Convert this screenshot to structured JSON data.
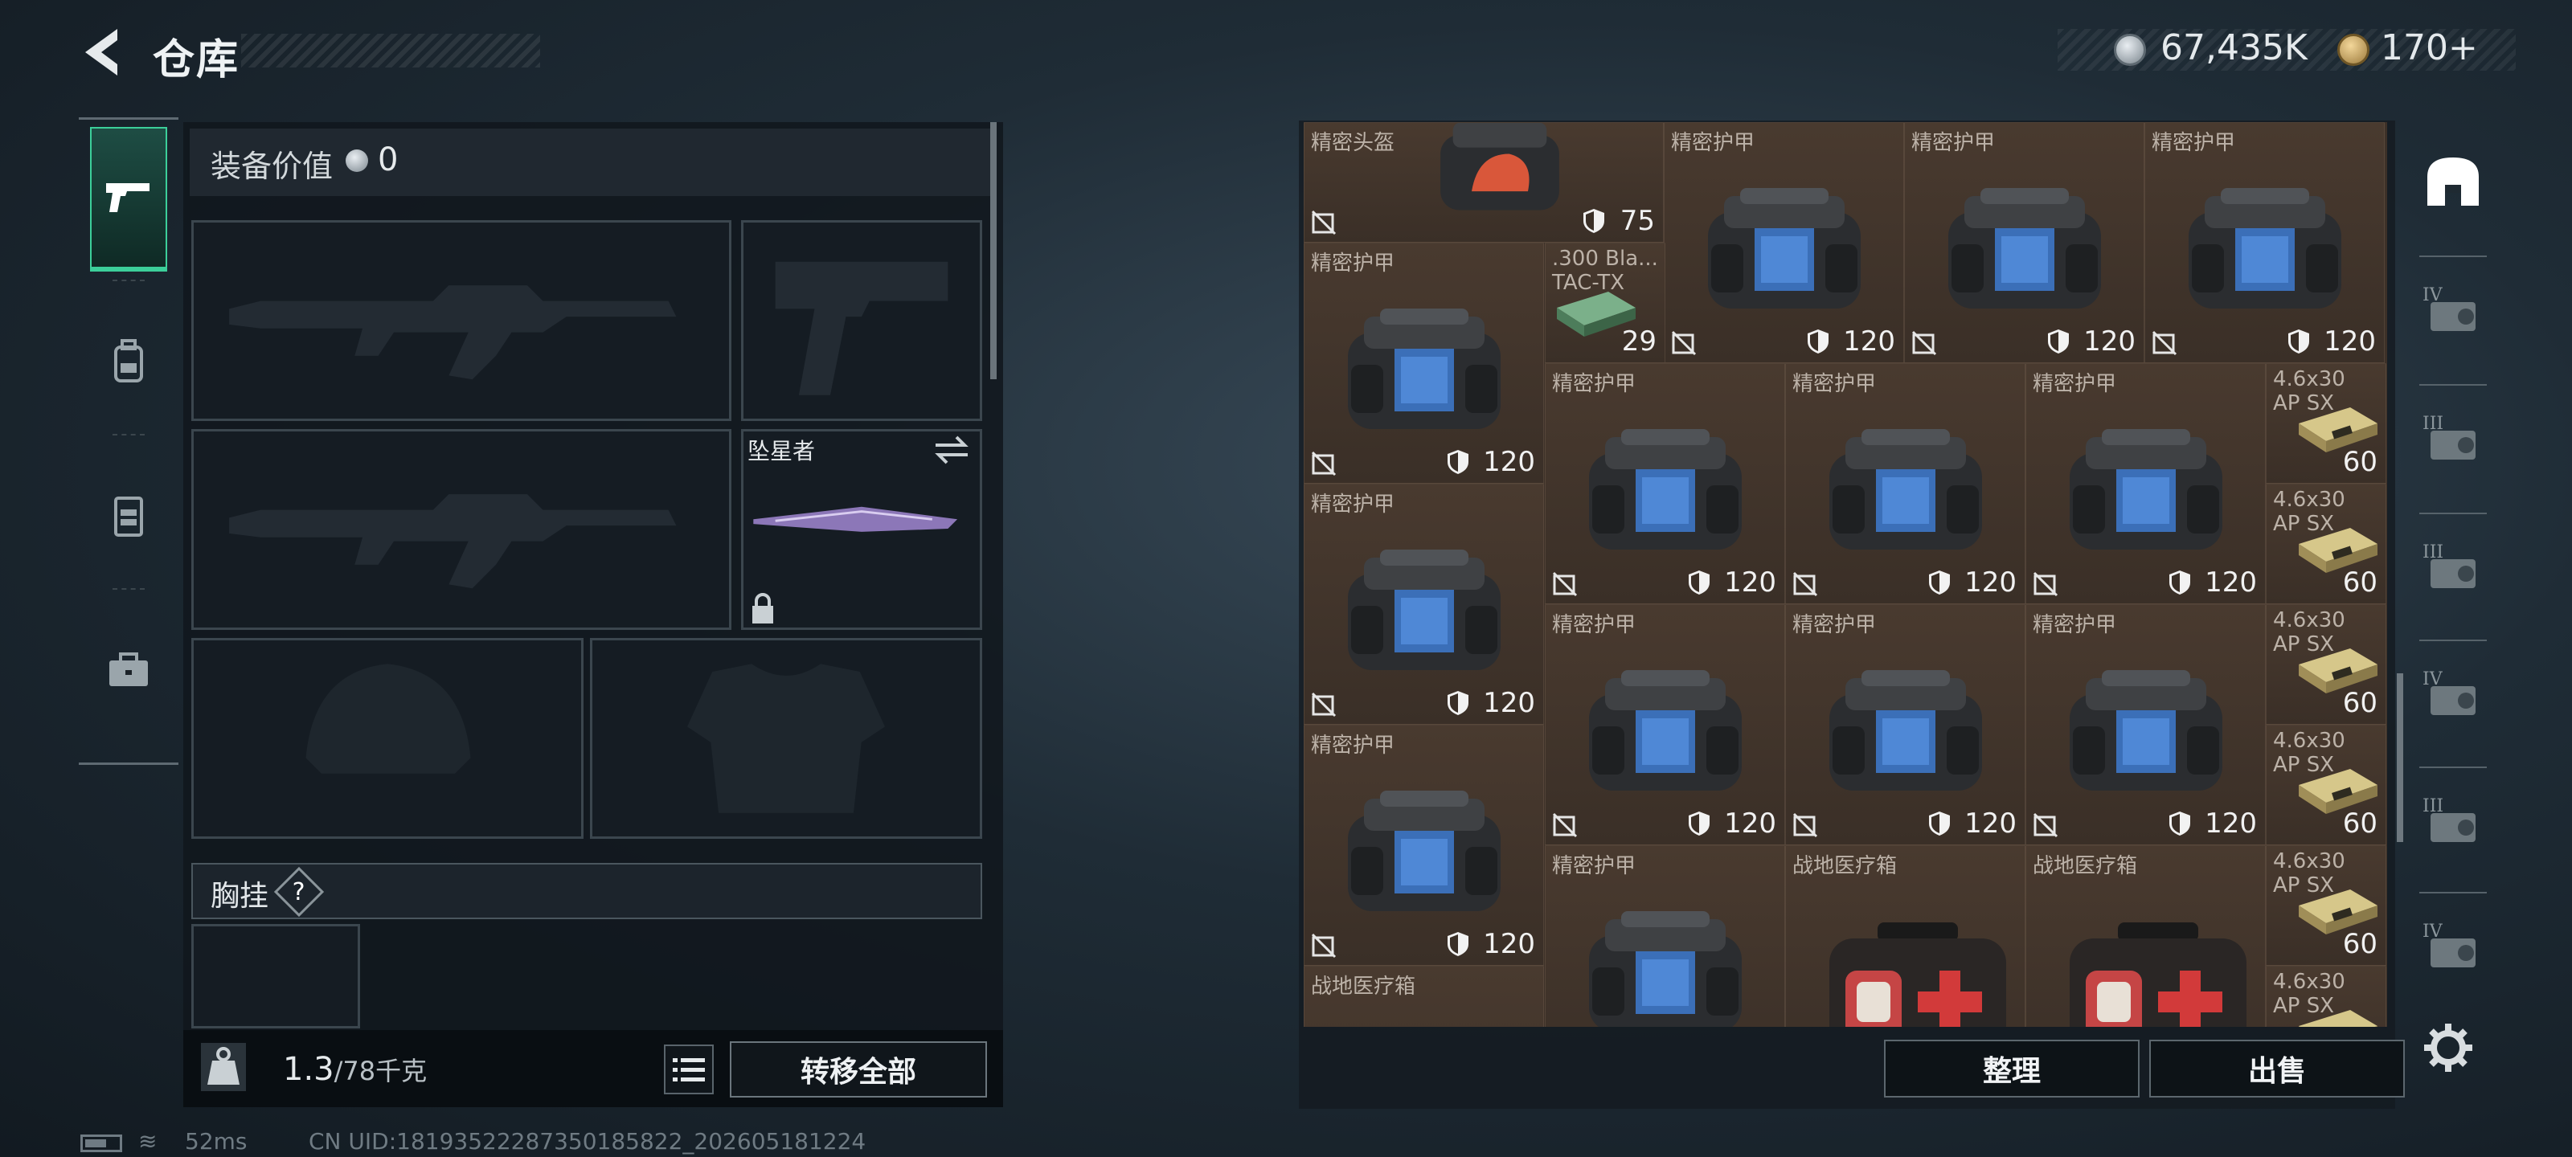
{
  "header": {
    "title": "仓库",
    "back_icon": "back-arrow-icon"
  },
  "currency": {
    "money": "67,435K",
    "tickets": "170+",
    "tiny": "",
    "money_icon": "coin-icon",
    "ticket_icon": "triangle-coin-icon"
  },
  "tabs": [
    {
      "name": "weapons",
      "icon": "pistol-icon",
      "selected": true
    },
    {
      "name": "backpack",
      "icon": "backpack-icon"
    },
    {
      "name": "rig",
      "icon": "chest-rig-icon"
    },
    {
      "name": "case",
      "icon": "briefcase-icon"
    }
  ],
  "equipment": {
    "value_label": "装备价值",
    "value": "0",
    "melee_label": "坠星者",
    "rig_label": "胸挂",
    "help": "?"
  },
  "footer_left": {
    "weight": "1.3",
    "capacity": "/78千克",
    "transfer_label": "转移全部"
  },
  "status": {
    "ping": "52ms",
    "uid": "CN UID:18193522287350185822_202605181224"
  },
  "grid": {
    "cells": [
      {
        "name": "精密头盔",
        "qty": "75",
        "kind": "helmet"
      },
      {
        "name": "精密护甲",
        "qty": "120",
        "kind": "vest"
      },
      {
        "name": "精密护甲",
        "qty": "120",
        "kind": "vest"
      },
      {
        "name": "精密护甲",
        "qty": "120",
        "kind": "vest"
      },
      {
        "name": "精密护甲",
        "qty": "120",
        "kind": "vest"
      },
      {
        "name": ".300 Bla...",
        "name2": "TAC-TX",
        "qty": "29",
        "kind": "ammo-green"
      },
      {
        "name": "精密护甲",
        "qty": "120",
        "kind": "vest"
      },
      {
        "name": "精密护甲",
        "qty": "120",
        "kind": "vest"
      },
      {
        "name": "精密护甲",
        "qty": "120",
        "kind": "vest"
      },
      {
        "name": "4.6x30",
        "name2": "AP SX",
        "qty": "60",
        "kind": "ammo"
      },
      {
        "name": "4.6x30",
        "name2": "AP SX",
        "qty": "60",
        "kind": "ammo"
      },
      {
        "name": "精密护甲",
        "qty": "120",
        "kind": "vest"
      },
      {
        "name": "精密护甲",
        "qty": "120",
        "kind": "vest"
      },
      {
        "name": "精密护甲",
        "qty": "120",
        "kind": "vest"
      },
      {
        "name": "精密护甲",
        "qty": "120",
        "kind": "vest"
      },
      {
        "name": "4.6x30",
        "name2": "AP SX",
        "qty": "60",
        "kind": "ammo"
      },
      {
        "name": "4.6x30",
        "name2": "AP SX",
        "qty": "60",
        "kind": "ammo"
      },
      {
        "name": "精密护甲",
        "qty": "120",
        "kind": "vest"
      },
      {
        "name": "精密护甲",
        "qty": "",
        "kind": "vest"
      },
      {
        "name": "战地医疗箱",
        "qty": "",
        "kind": "medkit"
      },
      {
        "name": "战地医疗箱",
        "qty": "",
        "kind": "medkit"
      },
      {
        "name": "4.6x30",
        "name2": "AP SX",
        "qty": "60",
        "kind": "ammo"
      },
      {
        "name": "战地医疗箱",
        "qty": "",
        "kind": "medkit-partial"
      },
      {
        "name": "4.6x30",
        "name2": "AP SX",
        "qty": "",
        "kind": "ammo"
      }
    ]
  },
  "rail": [
    {
      "icon": "armor-rack-icon",
      "label": ""
    },
    {
      "icon": "tier-iv-box-icon",
      "label": "IV"
    },
    {
      "icon": "tier-iii-box-icon",
      "label": "III"
    },
    {
      "icon": "tier-iii-box-icon",
      "label": "III"
    },
    {
      "icon": "tier-iv-box-icon",
      "label": "IV"
    },
    {
      "icon": "tier-iii-box-icon",
      "label": "III"
    },
    {
      "icon": "tier-iv-box-icon",
      "label": "IV"
    }
  ],
  "footer_right": {
    "sort_label": "整理",
    "sell_label": "出售",
    "settings_icon": "gear-icon"
  },
  "colors": {
    "accent": "#3ccf9a",
    "grid_bg": "#3d3128"
  }
}
